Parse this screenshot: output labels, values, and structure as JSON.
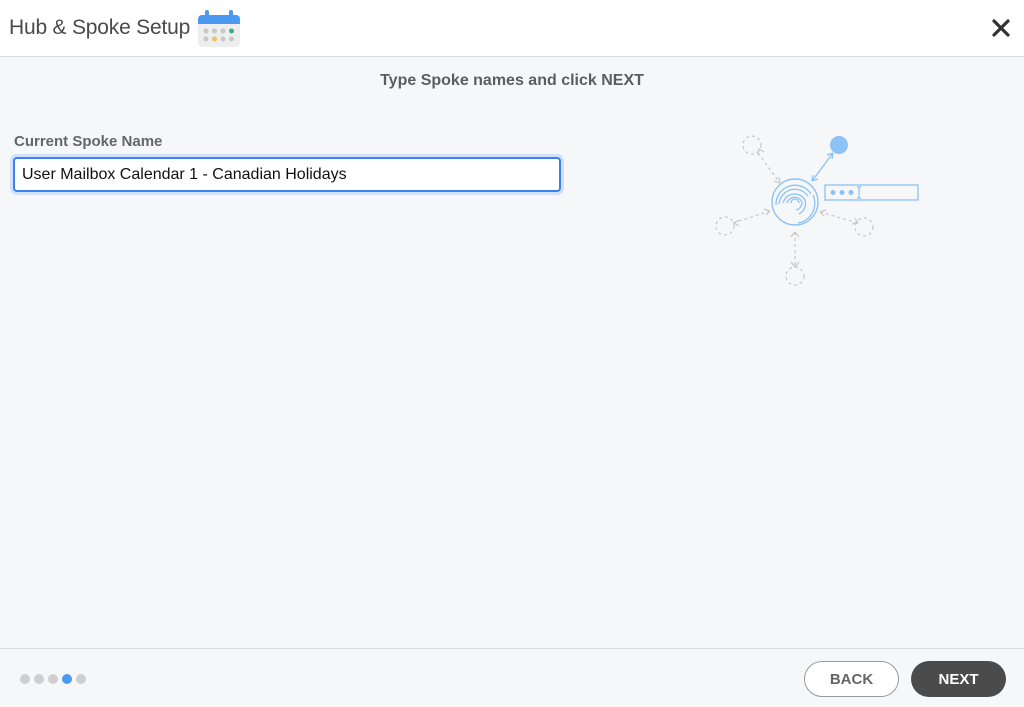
{
  "header": {
    "title": "Hub & Spoke Setup",
    "icon": "calendar-icon",
    "close_icon": "close-icon"
  },
  "main": {
    "instruction": "Type Spoke names and click NEXT",
    "field_label": "Current Spoke Name",
    "field_value": "User Mailbox Calendar 1 - Canadian Holidays",
    "illustration": "hub-spoke-illustration"
  },
  "footer": {
    "progress": {
      "total_steps": 5,
      "current_step": 4
    },
    "back_label": "BACK",
    "next_label": "NEXT"
  },
  "colors": {
    "accent": "#4a9af2",
    "input_border": "#3b82f0",
    "next_button": "#4b4b4b",
    "dot_inactive": "#cfcfcf"
  }
}
